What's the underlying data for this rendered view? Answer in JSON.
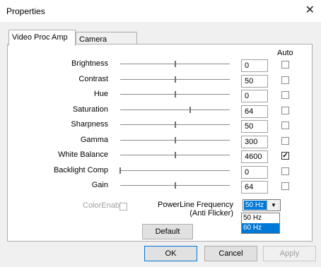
{
  "window": {
    "title": "Properties",
    "close_glyph": "✕"
  },
  "tabs": [
    {
      "label": "Video Proc Amp",
      "active": true
    },
    {
      "label": "Camera Control",
      "active": false
    }
  ],
  "auto_header": "Auto",
  "controls": [
    {
      "label": "Brightness",
      "value": "0",
      "slider_fraction": 0.5,
      "auto": false
    },
    {
      "label": "Contrast",
      "value": "50",
      "slider_fraction": 0.5,
      "auto": false
    },
    {
      "label": "Hue",
      "value": "0",
      "slider_fraction": 0.5,
      "auto": false
    },
    {
      "label": "Saturation",
      "value": "64",
      "slider_fraction": 0.64,
      "auto": false
    },
    {
      "label": "Sharpness",
      "value": "50",
      "slider_fraction": 0.5,
      "auto": false
    },
    {
      "label": "Gamma",
      "value": "300",
      "slider_fraction": 0.5,
      "auto": false
    },
    {
      "label": "White Balance",
      "value": "4600",
      "slider_fraction": 0.5,
      "auto": true
    },
    {
      "label": "Backlight Comp",
      "value": "0",
      "slider_fraction": 0.0,
      "auto": false
    },
    {
      "label": "Gain",
      "value": "64",
      "slider_fraction": 0.5,
      "auto": false
    }
  ],
  "color_enable": {
    "label": "ColorEnable",
    "checked": false
  },
  "powerline": {
    "label_line1": "PowerLine Frequency",
    "label_line2": "(Anti Flicker)",
    "selected": "50 Hz",
    "options": [
      {
        "label": "50 Hz",
        "highlighted": false
      },
      {
        "label": "60 Hz",
        "highlighted": true
      }
    ]
  },
  "buttons": {
    "default": "Default",
    "ok": "OK",
    "cancel": "Cancel",
    "apply": "Apply"
  },
  "icons": {
    "close": "close-icon",
    "dropdown": "chevron-down-icon",
    "checkmark": "checkmark-icon"
  },
  "colors": {
    "accent": "#0078d7",
    "panel": "#ffffff",
    "dialog": "#f0f0f0"
  }
}
